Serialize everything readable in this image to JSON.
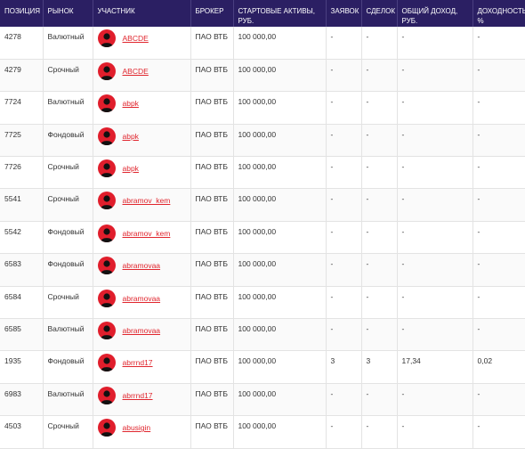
{
  "headers": {
    "position": "ПОЗИЦИЯ",
    "market": "РЫНОК",
    "participant": "УЧАСТНИК",
    "broker": "БРОКЕР",
    "start_assets": "СТАРТОВЫЕ АКТИВЫ, РУБ.",
    "orders": "ЗАЯВОК",
    "deals": "СДЕЛОК",
    "total_income": "ОБЩИЙ ДОХОД, РУБ.",
    "yield": "ДОХОДНОСТЬ, %"
  },
  "rows": [
    {
      "position": "4278",
      "market": "Валютный",
      "participant": "ABCDE",
      "broker": "ПАО ВТБ",
      "start_assets": "100 000,00",
      "orders": "-",
      "deals": "-",
      "total_income": "-",
      "yield": "-"
    },
    {
      "position": "4279",
      "market": "Срочный",
      "participant": "ABCDE",
      "broker": "ПАО ВТБ",
      "start_assets": "100 000,00",
      "orders": "-",
      "deals": "-",
      "total_income": "-",
      "yield": "-"
    },
    {
      "position": "7724",
      "market": "Валютный",
      "participant": "abpk",
      "broker": "ПАО ВТБ",
      "start_assets": "100 000,00",
      "orders": "-",
      "deals": "-",
      "total_income": "-",
      "yield": "-"
    },
    {
      "position": "7725",
      "market": "Фондовый",
      "participant": "abpk",
      "broker": "ПАО ВТБ",
      "start_assets": "100 000,00",
      "orders": "-",
      "deals": "-",
      "total_income": "-",
      "yield": "-"
    },
    {
      "position": "7726",
      "market": "Срочный",
      "participant": "abpk",
      "broker": "ПАО ВТБ",
      "start_assets": "100 000,00",
      "orders": "-",
      "deals": "-",
      "total_income": "-",
      "yield": "-"
    },
    {
      "position": "5541",
      "market": "Срочный",
      "participant": "abramov_kem",
      "broker": "ПАО ВТБ",
      "start_assets": "100 000,00",
      "orders": "-",
      "deals": "-",
      "total_income": "-",
      "yield": "-"
    },
    {
      "position": "5542",
      "market": "Фондовый",
      "participant": "abramov_kem",
      "broker": "ПАО ВТБ",
      "start_assets": "100 000,00",
      "orders": "-",
      "deals": "-",
      "total_income": "-",
      "yield": "-"
    },
    {
      "position": "6583",
      "market": "Фондовый",
      "participant": "abramovaa",
      "broker": "ПАО ВТБ",
      "start_assets": "100 000,00",
      "orders": "-",
      "deals": "-",
      "total_income": "-",
      "yield": "-"
    },
    {
      "position": "6584",
      "market": "Срочный",
      "participant": "abramovaa",
      "broker": "ПАО ВТБ",
      "start_assets": "100 000,00",
      "orders": "-",
      "deals": "-",
      "total_income": "-",
      "yield": "-"
    },
    {
      "position": "6585",
      "market": "Валютный",
      "participant": "abramovaa",
      "broker": "ПАО ВТБ",
      "start_assets": "100 000,00",
      "orders": "-",
      "deals": "-",
      "total_income": "-",
      "yield": "-"
    },
    {
      "position": "1935",
      "market": "Фондовый",
      "participant": "abrrnd17",
      "broker": "ПАО ВТБ",
      "start_assets": "100 000,00",
      "orders": "3",
      "deals": "3",
      "total_income": "17,34",
      "yield": "0,02"
    },
    {
      "position": "6983",
      "market": "Валютный",
      "participant": "abrrnd17",
      "broker": "ПАО ВТБ",
      "start_assets": "100 000,00",
      "orders": "-",
      "deals": "-",
      "total_income": "-",
      "yield": "-"
    },
    {
      "position": "4503",
      "market": "Срочный",
      "participant": "abusigin",
      "broker": "ПАО ВТБ",
      "start_assets": "100 000,00",
      "orders": "-",
      "deals": "-",
      "total_income": "-",
      "yield": "-"
    }
  ],
  "avatar_color": "#e01e2c",
  "link_color": "#e0262e",
  "header_bg": "#2b1f63"
}
